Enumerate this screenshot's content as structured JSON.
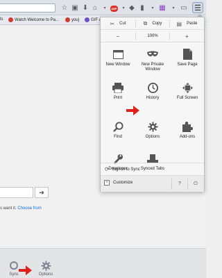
{
  "toolbar": {
    "icons": [
      "star-icon",
      "reader-icon",
      "download-icon",
      "home-icon",
      "adblock-icon",
      "pocket-icon",
      "clipboard-icon",
      "more-icon",
      "extension-icon",
      "lock-icon",
      "menu-icon"
    ],
    "adblock_label": "ABP",
    "menu_symbol": "☰"
  },
  "bookmarks": [
    {
      "label": "ls",
      "color": "#7a7a7a"
    },
    {
      "label": "Watch Welcome to Pa...",
      "color": "#d23a2f"
    },
    {
      "label": "youj",
      "color": "#cc3b2c"
    },
    {
      "label": "GIF a",
      "color": "#6b52c7"
    }
  ],
  "page": {
    "go_symbol": "➔",
    "hint_text": "s want it.",
    "hint_link": "Choose from"
  },
  "bottom_bar": {
    "sync_label": "Sync",
    "options_label": "Options"
  },
  "menu_panel": {
    "edit": {
      "cut": "Cut",
      "copy": "Copy",
      "paste": "Paste"
    },
    "zoom": {
      "minus": "−",
      "value": "100%",
      "plus": "+"
    },
    "items": [
      {
        "label": "New Window",
        "icon": "window-icon"
      },
      {
        "label": "New Private Window",
        "icon": "mask-icon"
      },
      {
        "label": "Save Page",
        "icon": "save-page-icon"
      },
      {
        "label": "Print",
        "icon": "printer-icon"
      },
      {
        "label": "History",
        "icon": "clock-icon"
      },
      {
        "label": "Full Screen",
        "icon": "fullscreen-icon"
      },
      {
        "label": "Find",
        "icon": "magnifier-icon"
      },
      {
        "label": "Options",
        "icon": "gear-icon"
      },
      {
        "label": "Add-ons",
        "icon": "puzzle-icon"
      },
      {
        "label": "Developer",
        "icon": "wrench-icon"
      },
      {
        "label": "Synced Tabs",
        "icon": "synced-tabs-icon"
      }
    ],
    "sign_in": "Sign in to Sync",
    "customize": "Customize",
    "help_symbol": "?",
    "power_symbol": "⏻"
  },
  "colors": {
    "annotation_arrow": "#e0201b",
    "link": "#0a6ccf"
  }
}
